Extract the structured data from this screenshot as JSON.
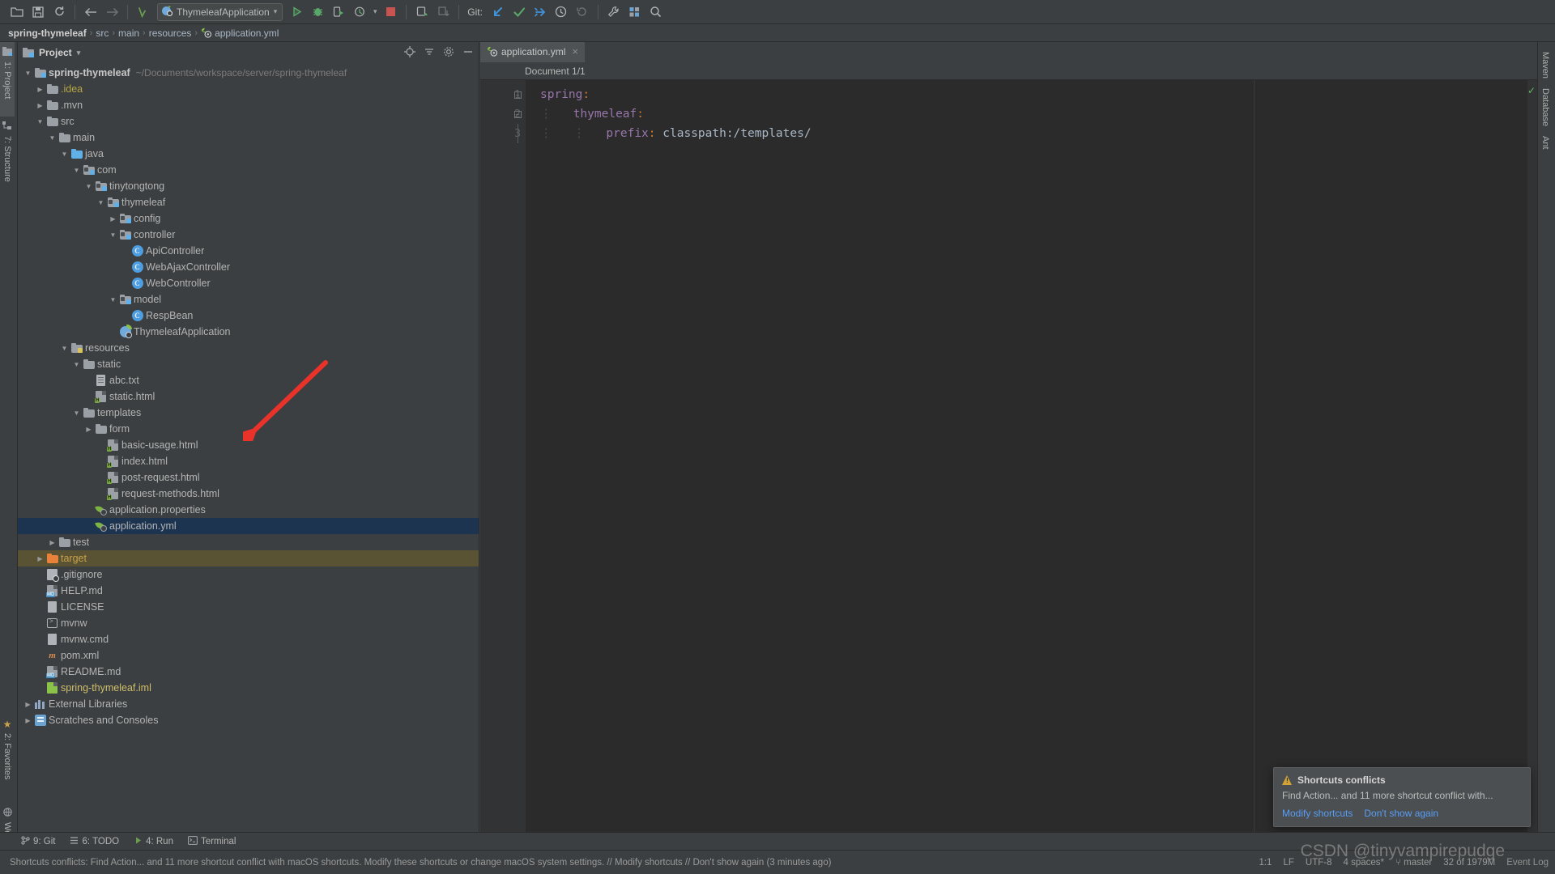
{
  "toolbar": {
    "icons": [
      "open-folder-icon",
      "save-icon",
      "sync-icon",
      "back-arrow-icon",
      "forward-arrow-icon",
      "undo-icon"
    ],
    "run_config": {
      "label": "ThymeleafApplication",
      "icon": "spring-boot-icon",
      "dropdown": "▾"
    },
    "action_icons": [
      "run-icon",
      "debug-icon",
      "run-with-coverage-icon",
      "profile-icon",
      "stop-icon",
      "build-icon",
      "sync-gradle-icon"
    ],
    "git_label": "Git:",
    "git_icons": [
      "update-project-icon",
      "commit-icon",
      "push-icon",
      "history-icon",
      "rollback-icon"
    ],
    "trailing_icons": [
      "settings-wrench-icon",
      "project-structure-icon",
      "search-everywhere-icon"
    ]
  },
  "breadcrumb": {
    "items": [
      {
        "label": "spring-thymeleaf",
        "bold": true
      },
      {
        "label": "src",
        "bold": false
      },
      {
        "label": "main",
        "bold": false
      },
      {
        "label": "resources",
        "bold": false
      },
      {
        "label": "application.yml",
        "bold": false,
        "icon": "yaml-spring-icon"
      }
    ],
    "separator": "›"
  },
  "left_stripe": {
    "top": [
      {
        "label": "1: Project",
        "active": true,
        "icon": "project-icon"
      },
      {
        "label": "7: Structure",
        "active": false,
        "icon": "structure-icon"
      }
    ],
    "bottom": [
      {
        "label": "2: Favorites",
        "active": false,
        "icon": "star-icon"
      },
      {
        "label": "Web",
        "active": false,
        "icon": "web-icon"
      }
    ]
  },
  "right_stripe": {
    "items": [
      {
        "label": "Maven",
        "icon": "maven-icon"
      },
      {
        "label": "Database",
        "icon": "database-icon"
      },
      {
        "label": "Ant",
        "icon": "ant-icon"
      }
    ]
  },
  "project_panel": {
    "title": "Project",
    "title_dropdown": "▾",
    "header_actions": [
      "target-icon",
      "collapse-all-icon",
      "settings-gear-icon",
      "hide-icon"
    ],
    "tree": [
      {
        "depth": 0,
        "arrow": "down",
        "icon": "project-root-icon",
        "label": "spring-thymeleaf",
        "bold": true,
        "path": "~/Documents/workspace/server/spring-thymeleaf"
      },
      {
        "depth": 1,
        "arrow": "right",
        "icon": "folder-icon",
        "label": ".idea",
        "color": "yellow"
      },
      {
        "depth": 1,
        "arrow": "right",
        "icon": "folder-icon",
        "label": ".mvn"
      },
      {
        "depth": 1,
        "arrow": "down",
        "icon": "folder-icon",
        "label": "src"
      },
      {
        "depth": 2,
        "arrow": "down",
        "icon": "folder-icon",
        "label": "main"
      },
      {
        "depth": 3,
        "arrow": "down",
        "icon": "source-folder-icon",
        "label": "java"
      },
      {
        "depth": 4,
        "arrow": "down",
        "icon": "package-icon",
        "label": "com"
      },
      {
        "depth": 5,
        "arrow": "down",
        "icon": "package-icon",
        "label": "tinytongtong"
      },
      {
        "depth": 6,
        "arrow": "down",
        "icon": "package-icon",
        "label": "thymeleaf"
      },
      {
        "depth": 7,
        "arrow": "right",
        "icon": "package-icon",
        "label": "config"
      },
      {
        "depth": 7,
        "arrow": "down",
        "icon": "package-icon",
        "label": "controller"
      },
      {
        "depth": 8,
        "arrow": "none",
        "icon": "java-class-icon",
        "label": "ApiController"
      },
      {
        "depth": 8,
        "arrow": "none",
        "icon": "java-class-icon",
        "label": "WebAjaxController"
      },
      {
        "depth": 8,
        "arrow": "none",
        "icon": "java-class-icon",
        "label": "WebController"
      },
      {
        "depth": 7,
        "arrow": "down",
        "icon": "package-icon",
        "label": "model"
      },
      {
        "depth": 8,
        "arrow": "none",
        "icon": "java-class-icon",
        "label": "RespBean"
      },
      {
        "depth": 7,
        "arrow": "none",
        "icon": "spring-boot-app-icon",
        "label": "ThymeleafApplication"
      },
      {
        "depth": 3,
        "arrow": "down",
        "icon": "resources-folder-icon",
        "label": "resources"
      },
      {
        "depth": 4,
        "arrow": "down",
        "icon": "folder-icon",
        "label": "static"
      },
      {
        "depth": 5,
        "arrow": "none",
        "icon": "text-file-icon",
        "label": "abc.txt"
      },
      {
        "depth": 5,
        "arrow": "none",
        "icon": "html-file-icon",
        "label": "static.html"
      },
      {
        "depth": 4,
        "arrow": "down",
        "icon": "folder-icon",
        "label": "templates"
      },
      {
        "depth": 5,
        "arrow": "right",
        "icon": "folder-icon",
        "label": "form"
      },
      {
        "depth": 6,
        "arrow": "none",
        "icon": "html-file-icon",
        "label": "basic-usage.html"
      },
      {
        "depth": 6,
        "arrow": "none",
        "icon": "html-file-icon",
        "label": "index.html"
      },
      {
        "depth": 6,
        "arrow": "none",
        "icon": "html-file-icon",
        "label": "post-request.html"
      },
      {
        "depth": 6,
        "arrow": "none",
        "icon": "html-file-icon",
        "label": "request-methods.html"
      },
      {
        "depth": 5,
        "arrow": "none",
        "icon": "spring-config-icon",
        "label": "application.properties"
      },
      {
        "depth": 5,
        "arrow": "none",
        "icon": "spring-config-icon",
        "label": "application.yml",
        "selected": true
      },
      {
        "depth": 2,
        "arrow": "right",
        "icon": "folder-icon",
        "label": "test"
      },
      {
        "depth": 1,
        "arrow": "right",
        "icon": "excluded-folder-icon",
        "label": "target",
        "color": "orange",
        "excluded": true
      },
      {
        "depth": 1,
        "arrow": "none",
        "icon": "gitignore-icon",
        "label": ".gitignore"
      },
      {
        "depth": 1,
        "arrow": "none",
        "icon": "markdown-file-icon",
        "label": "HELP.md"
      },
      {
        "depth": 1,
        "arrow": "none",
        "icon": "license-file-icon",
        "label": "LICENSE"
      },
      {
        "depth": 1,
        "arrow": "none",
        "icon": "shell-script-icon",
        "label": "mvnw"
      },
      {
        "depth": 1,
        "arrow": "none",
        "icon": "cmd-script-icon",
        "label": "mvnw.cmd"
      },
      {
        "depth": 1,
        "arrow": "none",
        "icon": "maven-pom-icon",
        "label": "pom.xml"
      },
      {
        "depth": 1,
        "arrow": "none",
        "icon": "markdown-file-icon",
        "label": "README.md"
      },
      {
        "depth": 1,
        "arrow": "none",
        "icon": "iml-module-icon",
        "label": "spring-thymeleaf.iml",
        "color": "iml"
      },
      {
        "depth": 0,
        "arrow": "right",
        "icon": "external-libraries-icon",
        "label": "External Libraries"
      },
      {
        "depth": 0,
        "arrow": "right",
        "icon": "scratches-icon",
        "label": "Scratches and Consoles"
      }
    ]
  },
  "editor": {
    "tab": {
      "label": "application.yml",
      "icon": "yaml-spring-icon",
      "close": "×"
    },
    "document_indicator": "Document 1/1",
    "lines": [
      {
        "no": "1",
        "indent": 0,
        "tokens": [
          {
            "t": "spring",
            "c": "key"
          },
          {
            "t": ":",
            "c": "punc"
          }
        ]
      },
      {
        "no": "2",
        "indent": 1,
        "tokens": [
          {
            "t": "thymeleaf",
            "c": "key"
          },
          {
            "t": ":",
            "c": "punc"
          }
        ]
      },
      {
        "no": "3",
        "indent": 2,
        "tokens": [
          {
            "t": "prefix",
            "c": "key"
          },
          {
            "t": ":",
            "c": "punc"
          },
          {
            "t": " classpath:/templates/",
            "c": "val"
          }
        ]
      }
    ],
    "inspection_status": "ok"
  },
  "notification": {
    "title": "Shortcuts conflicts",
    "icon": "warning-icon",
    "body": "Find Action... and 11 more shortcut conflict with...",
    "links": [
      {
        "label": "Modify shortcuts"
      },
      {
        "label": "Don't show again"
      }
    ]
  },
  "bottom_bar": {
    "items": [
      {
        "label": "9: Git",
        "icon": "git-branch-icon"
      },
      {
        "label": "6: TODO",
        "icon": "todo-icon"
      },
      {
        "label": "4: Run",
        "icon": "run-icon"
      },
      {
        "label": "Terminal",
        "icon": "terminal-icon"
      }
    ]
  },
  "status_bar": {
    "message": "Shortcuts conflicts: Find Action... and 11 more shortcut conflict with macOS shortcuts. Modify these shortcuts or change macOS system settings. // Modify shortcuts // Don't show again (3 minutes ago)",
    "right": [
      {
        "label": "1:1"
      },
      {
        "label": "LF"
      },
      {
        "label": "UTF-8"
      },
      {
        "label": "4 spaces*"
      },
      {
        "label": "master",
        "icon": "git-branch-icon"
      },
      {
        "label": "32 of 1979M",
        "icon": "memory-icon"
      }
    ],
    "event_log": "Event Log"
  },
  "watermark": "CSDN @tinyvampirepudge",
  "colors": {
    "accent_blue": "#589df6",
    "selection": "#1d3451",
    "excluded_row": "#5a5333",
    "folder_gray": "#9aa0a6",
    "folder_orange": "#e8813a",
    "yaml_key": "#9876aa",
    "yaml_value": "#a9b7c6",
    "annotation_arrow": "#e8322a",
    "panel_bg": "#3c3f41",
    "editor_bg": "#2b2b2b"
  }
}
